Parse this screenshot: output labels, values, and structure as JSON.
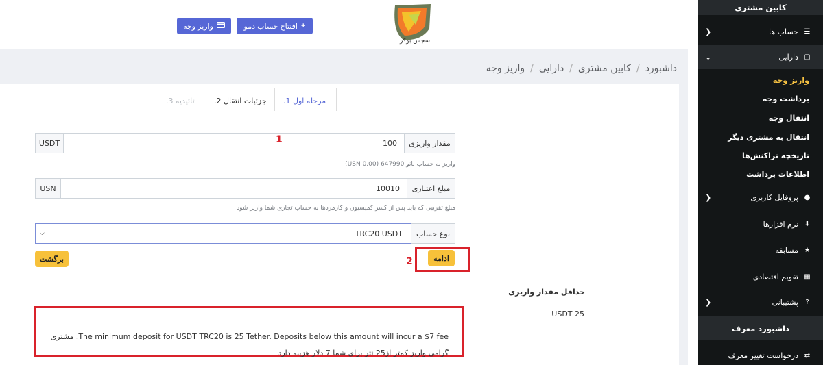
{
  "header": {
    "logo_text": "سجس بوکر",
    "demo_button": "افتتاح حساب دمو",
    "deposit_button": "واریز وجه"
  },
  "breadcrumb": [
    "داشبورد",
    "کابین مشتری",
    "دارایی",
    "واریز وجه"
  ],
  "steps": [
    {
      "label": "مرحله اول 1.",
      "state": "active"
    },
    {
      "label": "جزئیات انتقال 2.",
      "state": "normal"
    },
    {
      "label": "تائیدیه 3.",
      "state": "disabled"
    }
  ],
  "form": {
    "deposit_amount_label": "مقدار واریزی",
    "deposit_amount_value": "100",
    "deposit_currency": "USDT",
    "deposit_hint": "واریز به حساب نانو 647990 (USN 0.00)",
    "credit_amount_label": "مبلغ اعتباری",
    "credit_amount_value": "10010",
    "credit_currency": "USN",
    "credit_hint": "مبلغ تقریبی که باید پس از کسر کمیسیون و کارمزدها به حساب تجاری شما واریز شود",
    "account_type_label": "نوع حساب",
    "account_type_value": "TRC20 USDT",
    "continue_button": "ادامه",
    "back_button": "برگشت"
  },
  "minimum": {
    "title": "حداقل مقدار واریزی",
    "amount": "USDT 25",
    "note": "The minimum deposit for USDT TRC20 is 25 Tether. Deposits below this amount will incur a $7 fee. مشتری گرامی واریز کمتر از25 تتر برای شما 7 دلار هزینه دارد"
  },
  "annotations": {
    "mark1": "1",
    "mark2": "2"
  },
  "sidebar": {
    "cabin_title": "کابین مشتری",
    "accounts": "حساب ها",
    "assets": "دارایی",
    "sub_items": [
      "واریز وجه",
      "برداشت وجه",
      "انتقال وجه",
      "انتقال به مشتری دیگر",
      "تاریخچه تراکنش‌ها",
      "اطلاعات برداشت"
    ],
    "profile": "پروفایل کاربری",
    "software": "نرم افزارها",
    "competition": "مسابقه",
    "calendar": "تقویم اقتصادی",
    "support": "پشتیبانی",
    "referrer_title": "داشبورد معرف",
    "change_referrer": "درخواست تغییر معرف"
  },
  "colors": {
    "accent_blue": "#5667d6",
    "yellow": "#f7c13a",
    "annotation_red": "#d9222b",
    "sidebar_dark": "#131617"
  }
}
